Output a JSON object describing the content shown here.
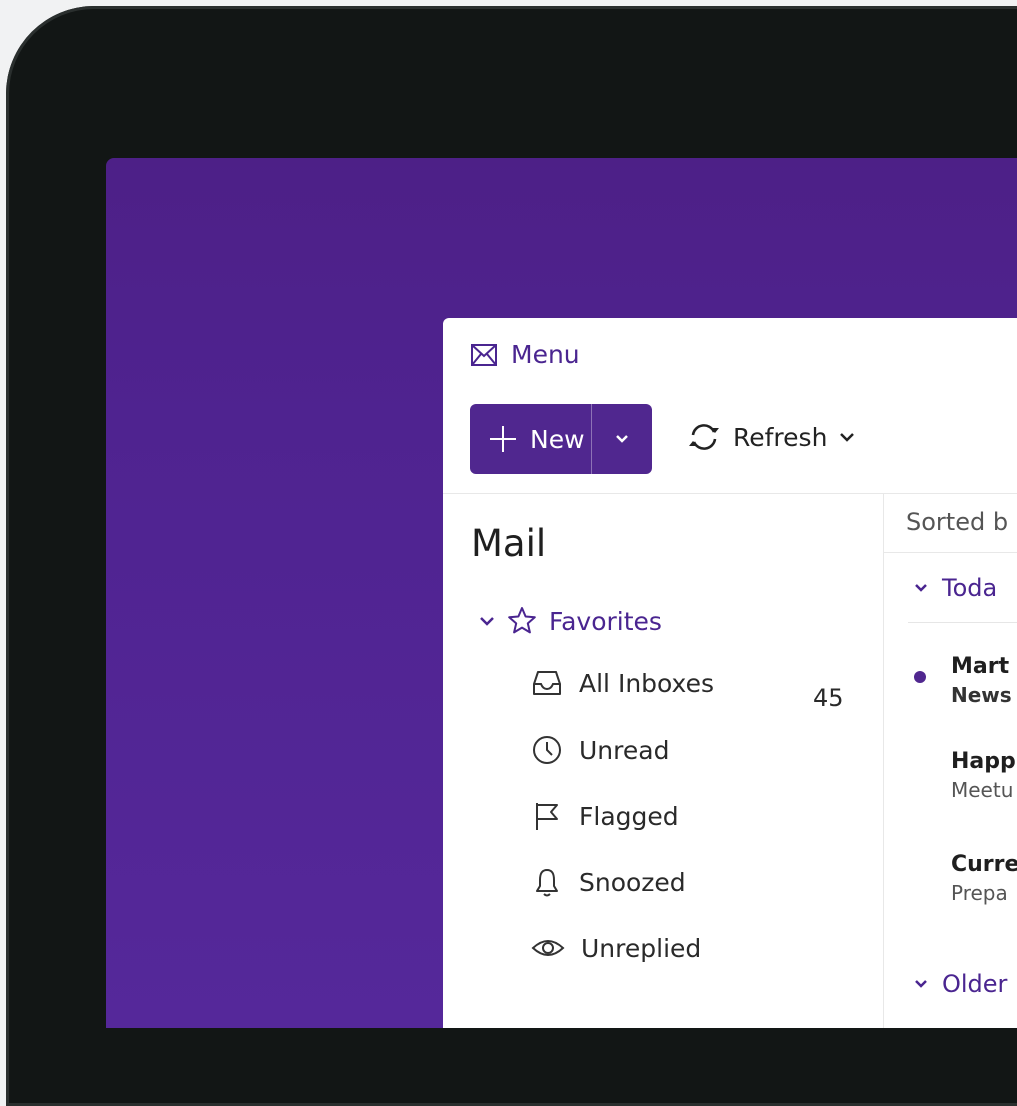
{
  "header": {
    "menu_label": "Menu",
    "new_label": "New",
    "refresh_label": "Refresh"
  },
  "sidebar": {
    "title": "Mail",
    "favorites_label": "Favorites",
    "items": [
      {
        "label": "All Inboxes",
        "icon": "inbox-icon",
        "count": "45"
      },
      {
        "label": "Unread",
        "icon": "clock-icon"
      },
      {
        "label": "Flagged",
        "icon": "flag-icon"
      },
      {
        "label": "Snoozed",
        "icon": "bell-icon"
      },
      {
        "label": "Unreplied",
        "icon": "eye-icon"
      }
    ]
  },
  "list": {
    "sort_label": "Sorted b",
    "groups": [
      "Toda",
      "Older"
    ],
    "messages": [
      {
        "from": "Mart",
        "subject": "News",
        "unread": true
      },
      {
        "from": "Happ",
        "subject": "Meetu",
        "unread": false
      },
      {
        "from": "Curre",
        "subject": "Prepa",
        "unread": false
      }
    ]
  },
  "colors": {
    "accent": "#50278f",
    "background": "#4f2390",
    "bezel": "#121615"
  }
}
